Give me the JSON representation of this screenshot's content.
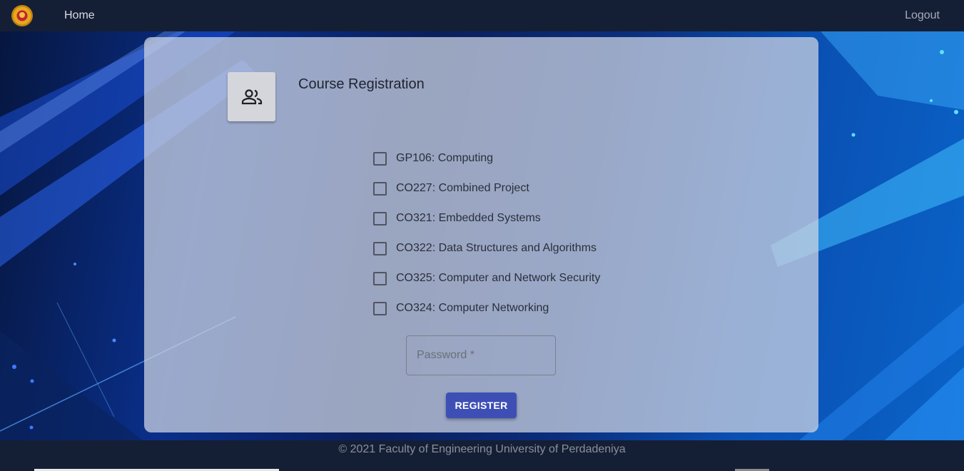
{
  "nav": {
    "home": "Home",
    "logout": "Logout"
  },
  "form": {
    "title": "Course Registration",
    "courses": [
      "GP106: Computing",
      "CO227: Combined Project",
      "CO321: Embedded Systems",
      "CO322: Data Structures and Algorithms",
      "CO325: Computer and Network Security",
      "CO324: Computer Networking"
    ],
    "password_placeholder": "Password *",
    "register": "REGISTER"
  },
  "footer": {
    "text": "© 2021 Faculty of Engineering University of Perdadeniya"
  },
  "icons": {
    "logo": "university-logo-icon",
    "users": "people-icon"
  },
  "colors": {
    "navbar": "#141f36",
    "button": "#3d4fb5"
  }
}
